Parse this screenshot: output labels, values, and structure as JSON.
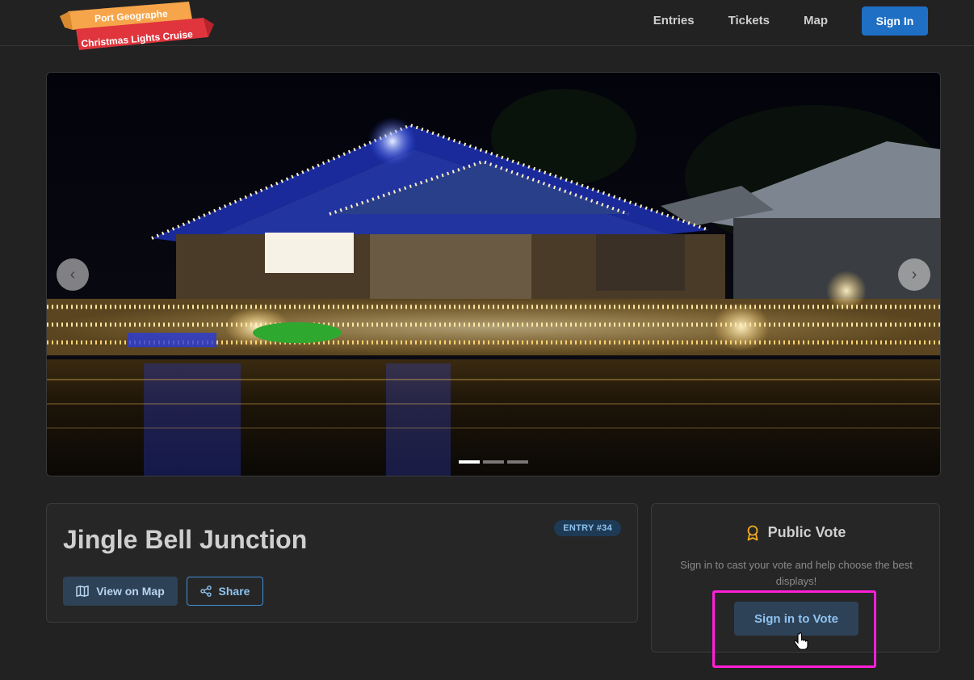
{
  "header": {
    "logo_line1": "Port Geographe",
    "logo_line2": "Christmas Lights Cruise",
    "nav": [
      {
        "label": "Entries"
      },
      {
        "label": "Tickets"
      },
      {
        "label": "Map"
      }
    ],
    "signin_label": "Sign In"
  },
  "carousel": {
    "prev_icon": "chevron-left-icon",
    "next_icon": "chevron-right-icon",
    "slide_count": 3,
    "active_slide": 1
  },
  "entry": {
    "title": "Jingle Bell Junction",
    "badge": "ENTRY #34",
    "map_button": "View on Map",
    "share_button": "Share"
  },
  "vote": {
    "title": "Public Vote",
    "description": "Sign in to cast your vote and help choose the best displays!",
    "button": "Sign in to Vote"
  },
  "colors": {
    "background": "#222222",
    "primary": "#1f6fc5",
    "badge_bg": "#1e3a55",
    "highlight": "#ff1fd8",
    "award_icon": "#f0a91f"
  }
}
